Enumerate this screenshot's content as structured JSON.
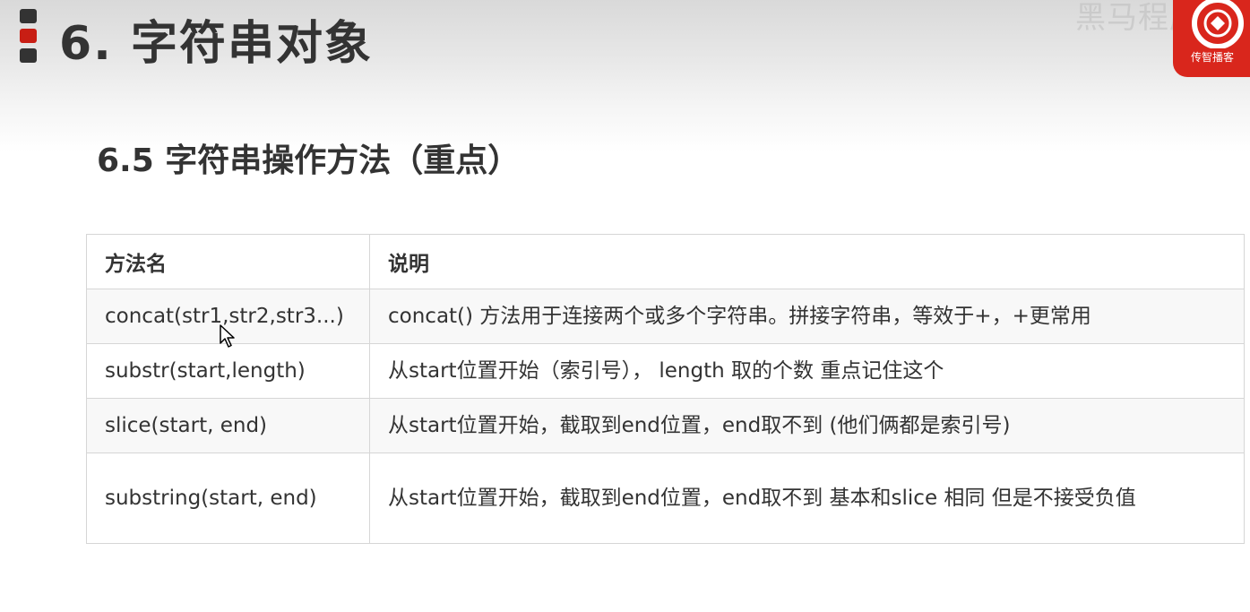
{
  "header": {
    "chapter_title": "6. 字符串对象",
    "watermark": "黑马程序员",
    "logo_text": "传智播客"
  },
  "section": {
    "title": "6.5 字符串操作方法（重点）"
  },
  "table": {
    "columns": [
      "方法名",
      "说明"
    ],
    "rows": [
      {
        "method": "concat(str1,str2,str3...)",
        "description": "concat() 方法用于连接两个或多个字符串。拼接字符串，等效于+，+更常用"
      },
      {
        "method": "substr(start,length)",
        "description": "从start位置开始（索引号）， length 取的个数   重点记住这个"
      },
      {
        "method": "slice(start, end)",
        "description": "从start位置开始，截取到end位置，end取不到 (他们俩都是索引号)"
      },
      {
        "method": "substring(start, end)",
        "description": "从start位置开始，截取到end位置，end取不到   基本和slice 相同 但是不接受负值"
      }
    ]
  },
  "colors": {
    "accent_red": "#c81e14",
    "logo_red": "#d9261c",
    "text": "#333333",
    "border": "#d6d6d6"
  },
  "icons": {
    "title_marker": "three-bar-marker-icon",
    "logo": "logo-emblem-icon",
    "cursor": "mouse-pointer-icon"
  }
}
